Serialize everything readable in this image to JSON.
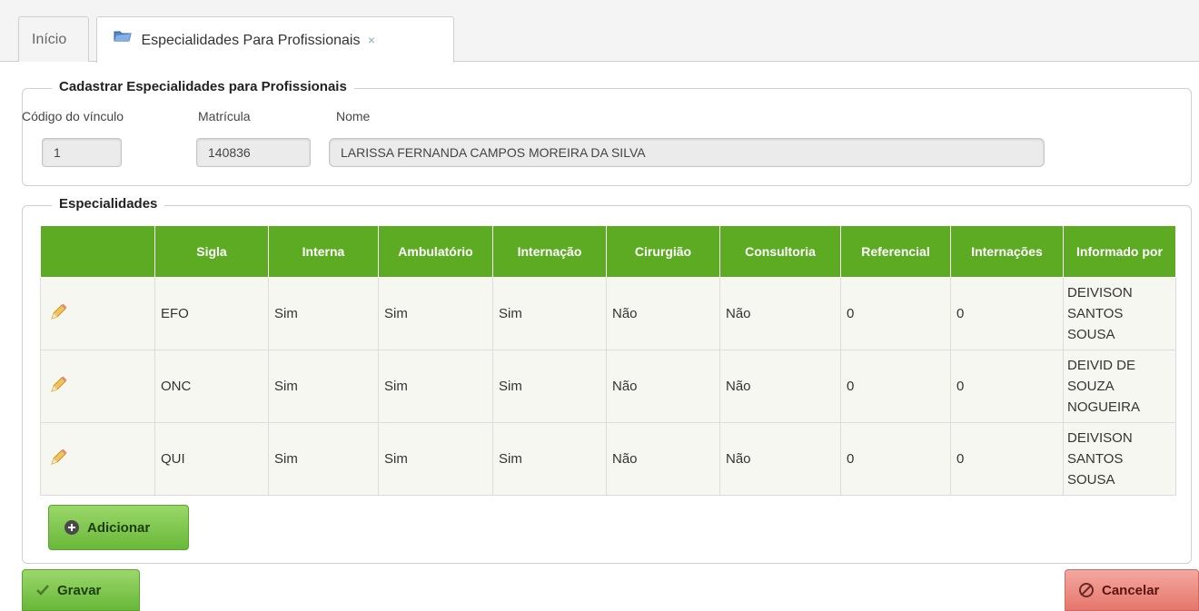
{
  "tabs": {
    "home_label": "Início",
    "active_label": "Especialidades Para Profissionais",
    "close_glyph": "×"
  },
  "form": {
    "legend": "Cadastrar Especialidades para Profissionais",
    "codigo_label": "Código do vínculo",
    "codigo_value": "1",
    "matricula_label": "Matrícula",
    "matricula_value": "140836",
    "nome_label": "Nome",
    "nome_value": "LARISSA FERNANDA CAMPOS MOREIRA DA SILVA"
  },
  "especialidades": {
    "legend": "Especialidades",
    "columns": [
      "",
      "Sigla",
      "Interna",
      "Ambulatório",
      "Internação",
      "Cirurgião",
      "Consultoria",
      "Referencial",
      "Internações",
      "Informado por"
    ],
    "rows": [
      {
        "sigla": "EFO",
        "interna": "Sim",
        "ambulatorio": "Sim",
        "internacao": "Sim",
        "cirurgiao": "Não",
        "consultoria": "Não",
        "referencial": "0",
        "internacoes": "0",
        "informado_por": "DEIVISON SANTOS SOUSA"
      },
      {
        "sigla": "ONC",
        "interna": "Sim",
        "ambulatorio": "Sim",
        "internacao": "Sim",
        "cirurgiao": "Não",
        "consultoria": "Não",
        "referencial": "0",
        "internacoes": "0",
        "informado_por": "DEIVID DE SOUZA NOGUEIRA"
      },
      {
        "sigla": "QUI",
        "interna": "Sim",
        "ambulatorio": "Sim",
        "internacao": "Sim",
        "cirurgiao": "Não",
        "consultoria": "Não",
        "referencial": "0",
        "internacoes": "0",
        "informado_por": "DEIVISON SANTOS SOUSA"
      }
    ],
    "add_label": "Adicionar"
  },
  "actions": {
    "save_label": "Gravar",
    "cancel_label": "Cancelar"
  },
  "icons": {
    "tab": "folder-icon",
    "edit": "pencil-icon",
    "add": "plus-circle-icon",
    "save": "check-icon",
    "cancel": "cancel-icon"
  },
  "colors": {
    "header_green": "#5cab22",
    "button_green": "#7cc44a",
    "button_red": "#eb8a80"
  }
}
